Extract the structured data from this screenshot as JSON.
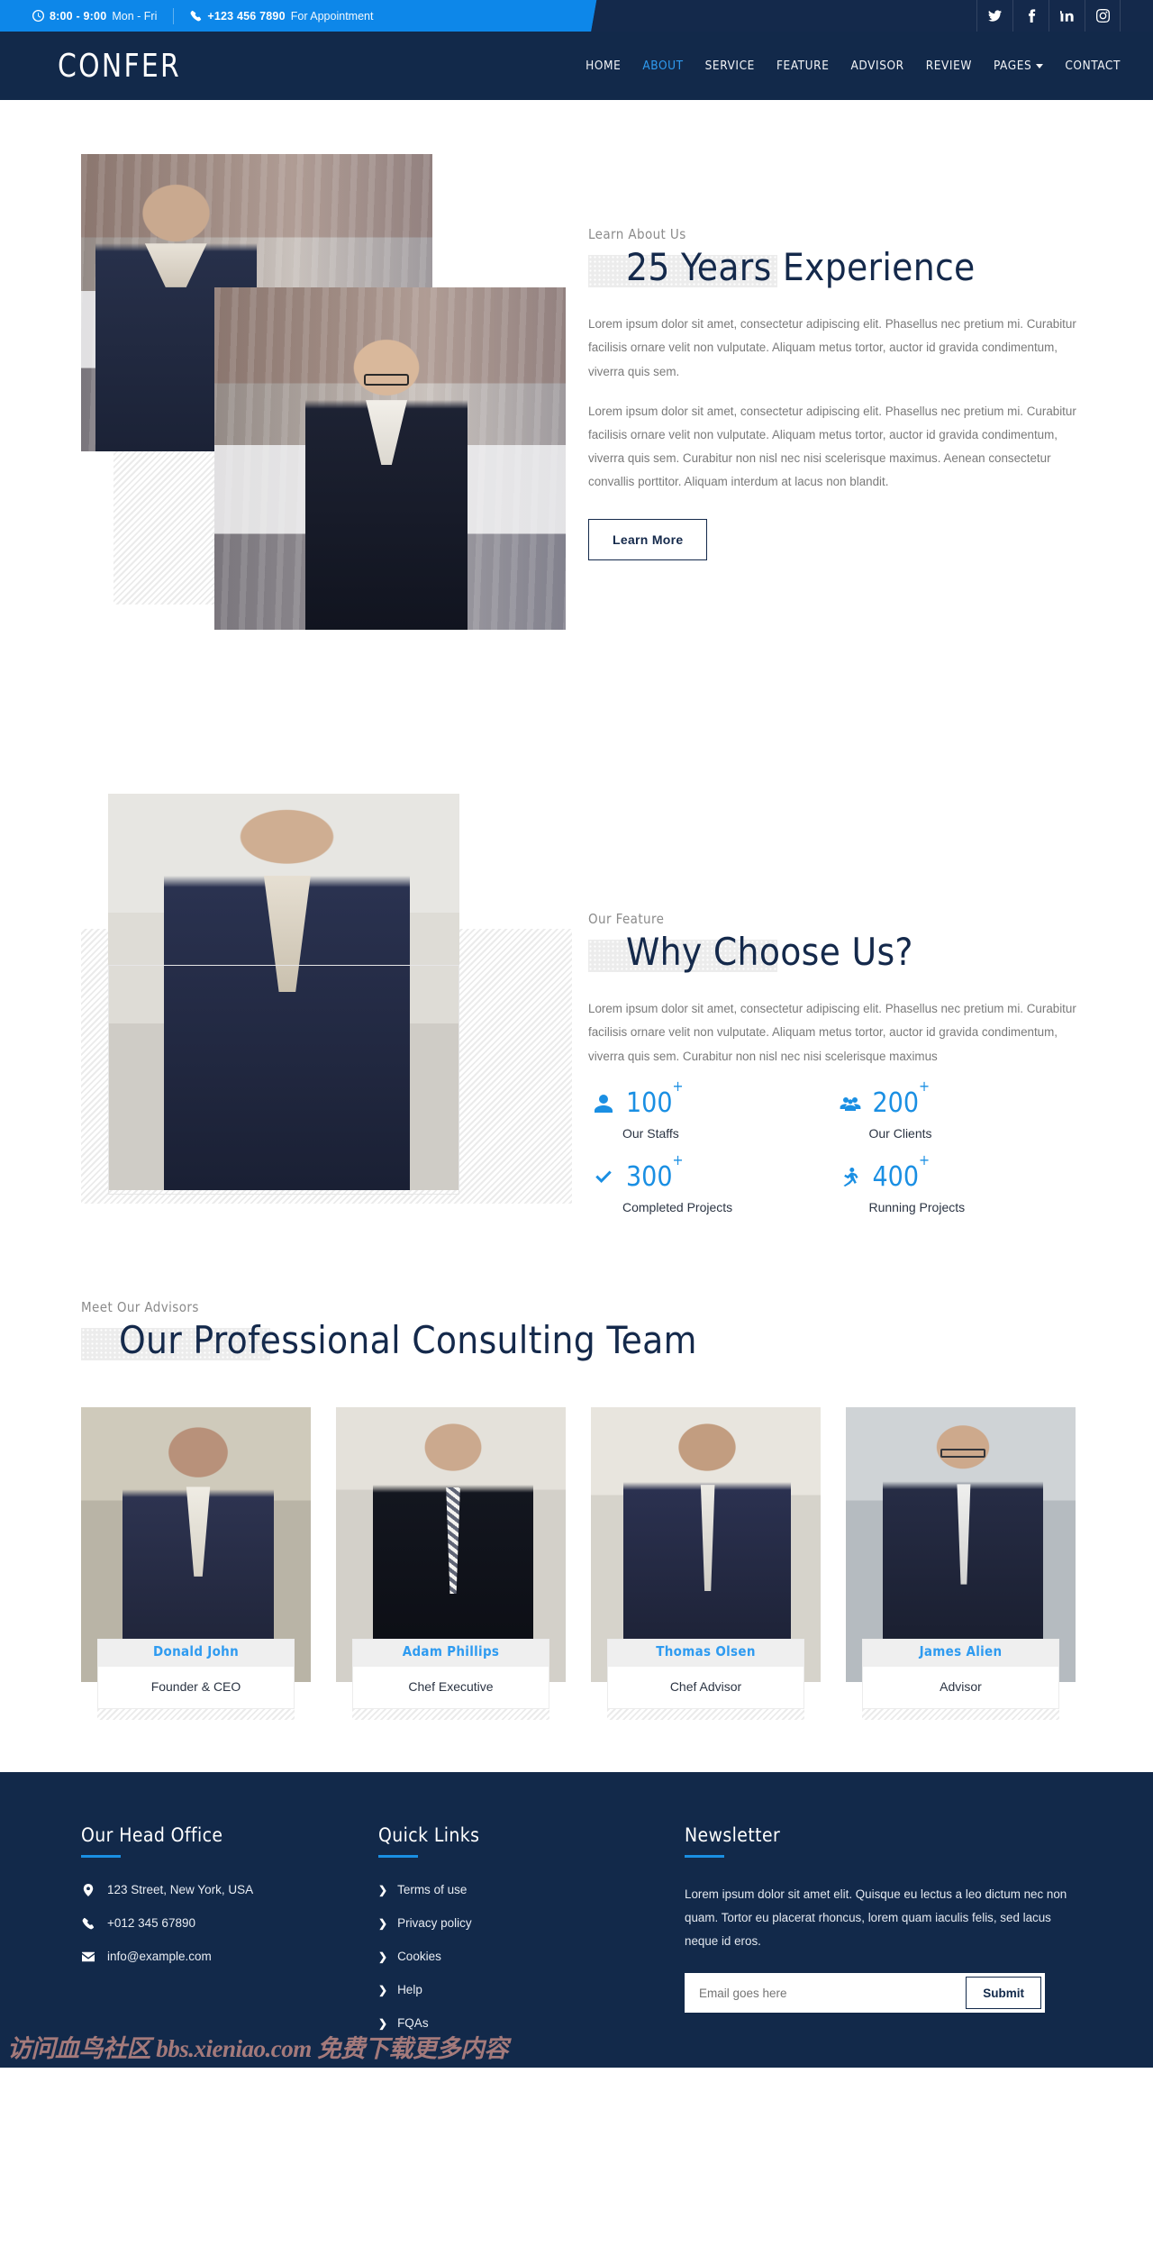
{
  "topbar": {
    "hours_icon": "clock-icon",
    "hours_time": "8:00 - 9:00",
    "hours_days": "Mon - Fri",
    "phone_icon": "phone-icon",
    "phone_number": "+123 456 7890",
    "phone_note": "For Appointment",
    "socials": [
      {
        "name": "twitter-icon",
        "label": "Twitter"
      },
      {
        "name": "facebook-icon",
        "label": "Facebook"
      },
      {
        "name": "linkedin-icon",
        "label": "LinkedIn"
      },
      {
        "name": "instagram-icon",
        "label": "Instagram"
      }
    ],
    "bg_color": "#0d87e9"
  },
  "navbar": {
    "logo": "CONFER",
    "bg_color": "#12294a",
    "active_color": "#2f9bf0",
    "links": [
      {
        "label": "HOME",
        "active": false
      },
      {
        "label": "ABOUT",
        "active": true
      },
      {
        "label": "SERVICE",
        "active": false
      },
      {
        "label": "FEATURE",
        "active": false
      },
      {
        "label": "ADVISOR",
        "active": false
      },
      {
        "label": "REVIEW",
        "active": false
      },
      {
        "label": "PAGES",
        "active": false,
        "dropdown": true
      },
      {
        "label": "CONTACT",
        "active": false
      }
    ]
  },
  "about": {
    "sub_label": "Learn About Us",
    "heading": "25 Years Experience",
    "paragraph_1": "Lorem ipsum dolor sit amet, consectetur adipiscing elit. Phasellus nec pretium mi. Curabitur facilisis ornare velit non vulputate. Aliquam metus tortor, auctor id gravida condimentum, viverra quis sem.",
    "paragraph_2": "Lorem ipsum dolor sit amet, consectetur adipiscing elit. Phasellus nec pretium mi. Curabitur facilisis ornare velit non vulputate. Aliquam metus tortor, auctor id gravida condimentum, viverra quis sem. Curabitur non nisl nec nisi scelerisque maximus. Aenean consectetur convallis porttitor. Aliquam interdum at lacus non blandit.",
    "button_label": "Learn More",
    "image_1_alt": "businessman-arms-crossed-office",
    "image_2_alt": "businesswoman-glasses-arms-crossed-office"
  },
  "feature": {
    "sub_label": "Our Feature",
    "heading": "Why Choose Us?",
    "paragraph": "Lorem ipsum dolor sit amet, consectetur adipiscing elit. Phasellus nec pretium mi. Curabitur facilisis ornare velit non vulputate. Aliquam metus tortor, auctor id gravida condimentum, viverra quis sem. Curabitur non nisl nec nisi scelerisque maximus",
    "image_alt": "young-businessman-portrait",
    "accent_color": "#1a8fe3",
    "counters": [
      {
        "icon": "user-icon",
        "value": "100",
        "suffix": "+",
        "label": "Our Staffs"
      },
      {
        "icon": "users-icon",
        "value": "200",
        "suffix": "+",
        "label": "Our Clients"
      },
      {
        "icon": "check-icon",
        "value": "300",
        "suffix": "+",
        "label": "Completed Projects"
      },
      {
        "icon": "running-icon",
        "value": "400",
        "suffix": "+",
        "label": "Running Projects"
      }
    ]
  },
  "team": {
    "sub_label": "Meet Our Advisors",
    "heading": "Our Professional Consulting Team",
    "members": [
      {
        "name": "Donald John",
        "role": "Founder & CEO",
        "photo_alt": "advisor-portrait-1"
      },
      {
        "name": "Adam Phillips",
        "role": "Chef Executive",
        "photo_alt": "advisor-portrait-2"
      },
      {
        "name": "Thomas Olsen",
        "role": "Chef Advisor",
        "photo_alt": "advisor-portrait-3"
      },
      {
        "name": "James Alien",
        "role": "Advisor",
        "photo_alt": "advisor-portrait-4"
      }
    ]
  },
  "footer": {
    "bg_color": "#12294a",
    "rule_color": "#1a8fe3",
    "office": {
      "title": "Our Head Office",
      "address": "123 Street, New York, USA",
      "phone": "+012 345 67890",
      "email": "info@example.com",
      "address_icon": "location-pin-icon",
      "phone_icon": "phone-icon",
      "email_icon": "envelope-icon"
    },
    "quick_links": {
      "title": "Quick Links",
      "items": [
        "Terms of use",
        "Privacy policy",
        "Cookies",
        "Help",
        "FQAs"
      ]
    },
    "newsletter": {
      "title": "Newsletter",
      "text": "Lorem ipsum dolor sit amet elit. Quisque eu lectus a leo dictum nec non quam. Tortor eu placerat rhoncus, lorem quam iaculis felis, sed lacus neque id eros.",
      "input_placeholder": "Email goes here",
      "input_value": "",
      "submit_label": "Submit"
    }
  },
  "watermark": {
    "text": "访问血鸟社区 bbs.xieniao.com 免费下载更多内容"
  }
}
